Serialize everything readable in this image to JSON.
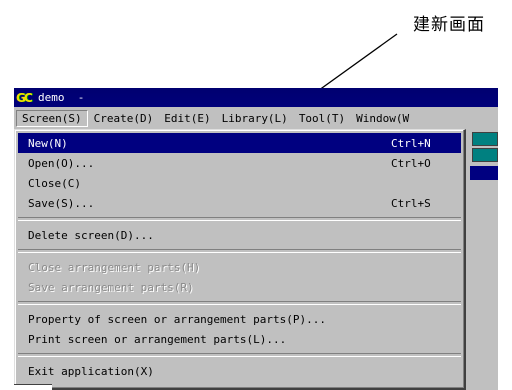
{
  "annotation": {
    "text": "建新画面"
  },
  "window": {
    "logo": "GC",
    "title": "demo  -"
  },
  "menubar": {
    "items": [
      {
        "label": "Screen(S)",
        "active": true
      },
      {
        "label": "Create(D)",
        "active": false
      },
      {
        "label": "Edit(E)",
        "active": false
      },
      {
        "label": "Library(L)",
        "active": false
      },
      {
        "label": "Tool(T)",
        "active": false
      },
      {
        "label": "Window(W",
        "active": false
      }
    ]
  },
  "screen_menu": {
    "items": [
      {
        "label": "New(N)",
        "shortcut": "Ctrl+N",
        "highlighted": true,
        "disabled": false
      },
      {
        "label": "Open(O)...",
        "shortcut": "Ctrl+O",
        "highlighted": false,
        "disabled": false
      },
      {
        "label": "Close(C)",
        "shortcut": "",
        "highlighted": false,
        "disabled": false
      },
      {
        "label": "Save(S)...",
        "shortcut": "Ctrl+S",
        "highlighted": false,
        "disabled": false
      },
      {
        "separator": true
      },
      {
        "label": "Delete screen(D)...",
        "shortcut": "",
        "highlighted": false,
        "disabled": false
      },
      {
        "separator": true
      },
      {
        "label": "Close arrangement parts(H)",
        "shortcut": "",
        "highlighted": false,
        "disabled": true
      },
      {
        "label": "Save arrangement parts(R)",
        "shortcut": "",
        "highlighted": false,
        "disabled": true
      },
      {
        "separator": true
      },
      {
        "label": "Property of screen or arrangement parts(P)...",
        "shortcut": "",
        "highlighted": false,
        "disabled": false
      },
      {
        "label": "Print screen or arrangement parts(L)...",
        "shortcut": "",
        "highlighted": false,
        "disabled": false
      },
      {
        "separator": true
      },
      {
        "label": "Exit application(X)",
        "shortcut": "",
        "highlighted": false,
        "disabled": false
      }
    ]
  },
  "colors": {
    "title_bar": "#00007a",
    "highlight": "#000080",
    "menu_face": "#c0c0c0"
  }
}
